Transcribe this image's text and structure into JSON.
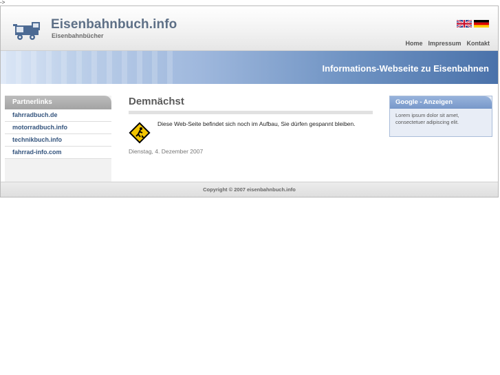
{
  "stray_text": "->",
  "header": {
    "title": "Eisenbahnbuch.info",
    "subtitle": "Eisenbahnbücher",
    "flags": [
      "uk-flag-icon",
      "german-flag-icon"
    ],
    "nav": [
      "Home",
      "Impressum",
      "Kontakt"
    ]
  },
  "banner": {
    "text": "Informations-Webseite zu Eisenbahnen"
  },
  "sidebar": {
    "title": "Partnerlinks",
    "links": [
      "fahrradbuch.de",
      "motorradbuch.info",
      "technikbuch.info",
      "fahrrad-info.com"
    ]
  },
  "main": {
    "title": "Demnächst",
    "notice": "Diese Web-Seite befindet sich noch im Aufbau, Sie dürfen gespannt bleiben.",
    "date": "Dienstag, 4. Dezember 2007",
    "icon": "construction-warning-icon"
  },
  "ads": {
    "title": "Google - Anzeigen",
    "text": "Lorem ipsum dolor sit amet, consectetuer adipiscing elit."
  },
  "footer": {
    "copyright": "Copyright © 2007 eisenbahnbuch.info"
  },
  "colors": {
    "title": "#5d6f86",
    "link": "#34547d",
    "banner_start": "#dbe6f6",
    "banner_end": "#4a72aa"
  }
}
